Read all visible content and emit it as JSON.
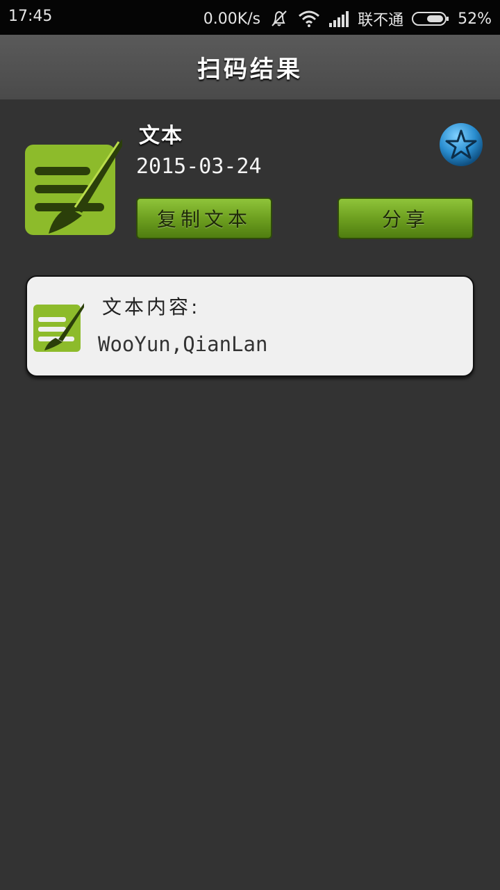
{
  "status_bar": {
    "time": "17:45",
    "net_speed": "0.00K/s",
    "carrier": "联不通",
    "battery": "52%",
    "icons": [
      "mute-icon",
      "wifi-icon",
      "signal-icon",
      "battery-icon"
    ]
  },
  "header": {
    "title": "扫码结果"
  },
  "result": {
    "type": "文本",
    "date": "2015-03-24",
    "copy_label": "复制文本",
    "share_label": "分享"
  },
  "content_card": {
    "label": "文本内容:",
    "text": "WooYun,QianLan"
  },
  "colors": {
    "background": "#333333",
    "accent_green": "#8dbb2b",
    "button_green": "#6ea020",
    "favorite_blue": "#2a8ed0"
  }
}
